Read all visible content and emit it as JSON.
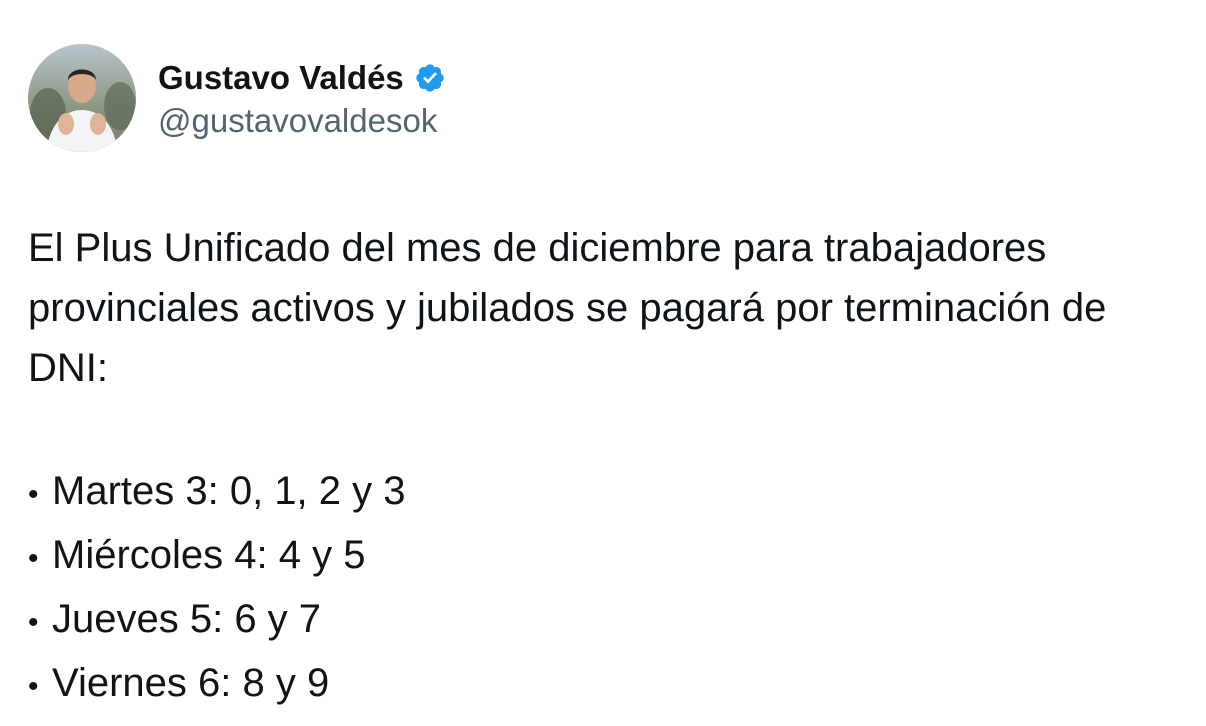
{
  "author": {
    "display_name": "Gustavo Valdés",
    "handle": "@gustavovaldesok",
    "verified": true,
    "verified_badge_color": "#1d9bf0",
    "avatar_icon": "profile-photo"
  },
  "tweet": {
    "text": "El Plus Unificado del mes de diciembre para trabajadores provinciales activos y jubilados se pagará por terminación de DNI:",
    "bullet_glyph": "•",
    "schedule": [
      "Martes 3: 0, 1, 2 y 3",
      "Miércoles 4: 4 y 5",
      "Jueves 5: 6 y 7",
      "Viernes 6: 8 y 9"
    ]
  }
}
